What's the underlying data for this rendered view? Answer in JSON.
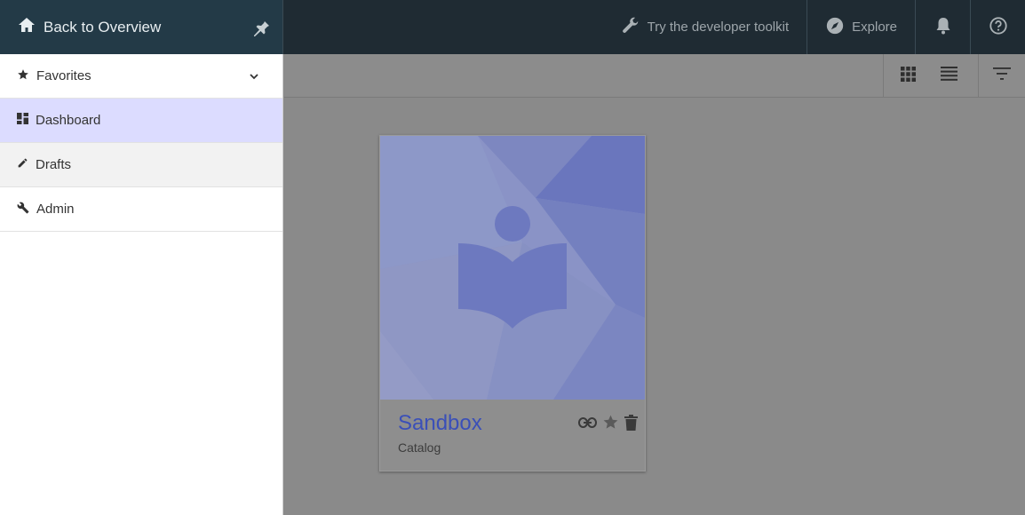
{
  "topbar": {
    "back_label": "Back to Overview",
    "toolkit_label": "Try the developer toolkit",
    "explore_label": "Explore",
    "icons": {
      "home": "home-icon",
      "pin": "pin-icon",
      "wrench": "wrench-icon",
      "compass": "compass-icon",
      "bell": "bell-icon",
      "help": "help-icon"
    }
  },
  "sidebar": {
    "items": [
      {
        "label": "Favorites",
        "icon": "star-icon",
        "expandable": true
      },
      {
        "label": "Dashboard",
        "icon": "dashboard-icon",
        "active": true
      },
      {
        "label": "Drafts",
        "icon": "pencil-icon"
      },
      {
        "label": "Admin",
        "icon": "wrench-icon"
      }
    ]
  },
  "toolbar": {
    "views": [
      "grid-view-icon",
      "list-view-icon"
    ],
    "filter": "filter-icon"
  },
  "card": {
    "title": "Sandbox",
    "subtitle": "Catalog",
    "actions": [
      "link-icon",
      "star-icon",
      "delete-icon"
    ]
  },
  "colors": {
    "topbar": "#1f2b33",
    "top_left": "#233a47",
    "active_item": "#dcdcff",
    "card_title": "#3a4fb8",
    "overlay": "#8a8a8a"
  }
}
